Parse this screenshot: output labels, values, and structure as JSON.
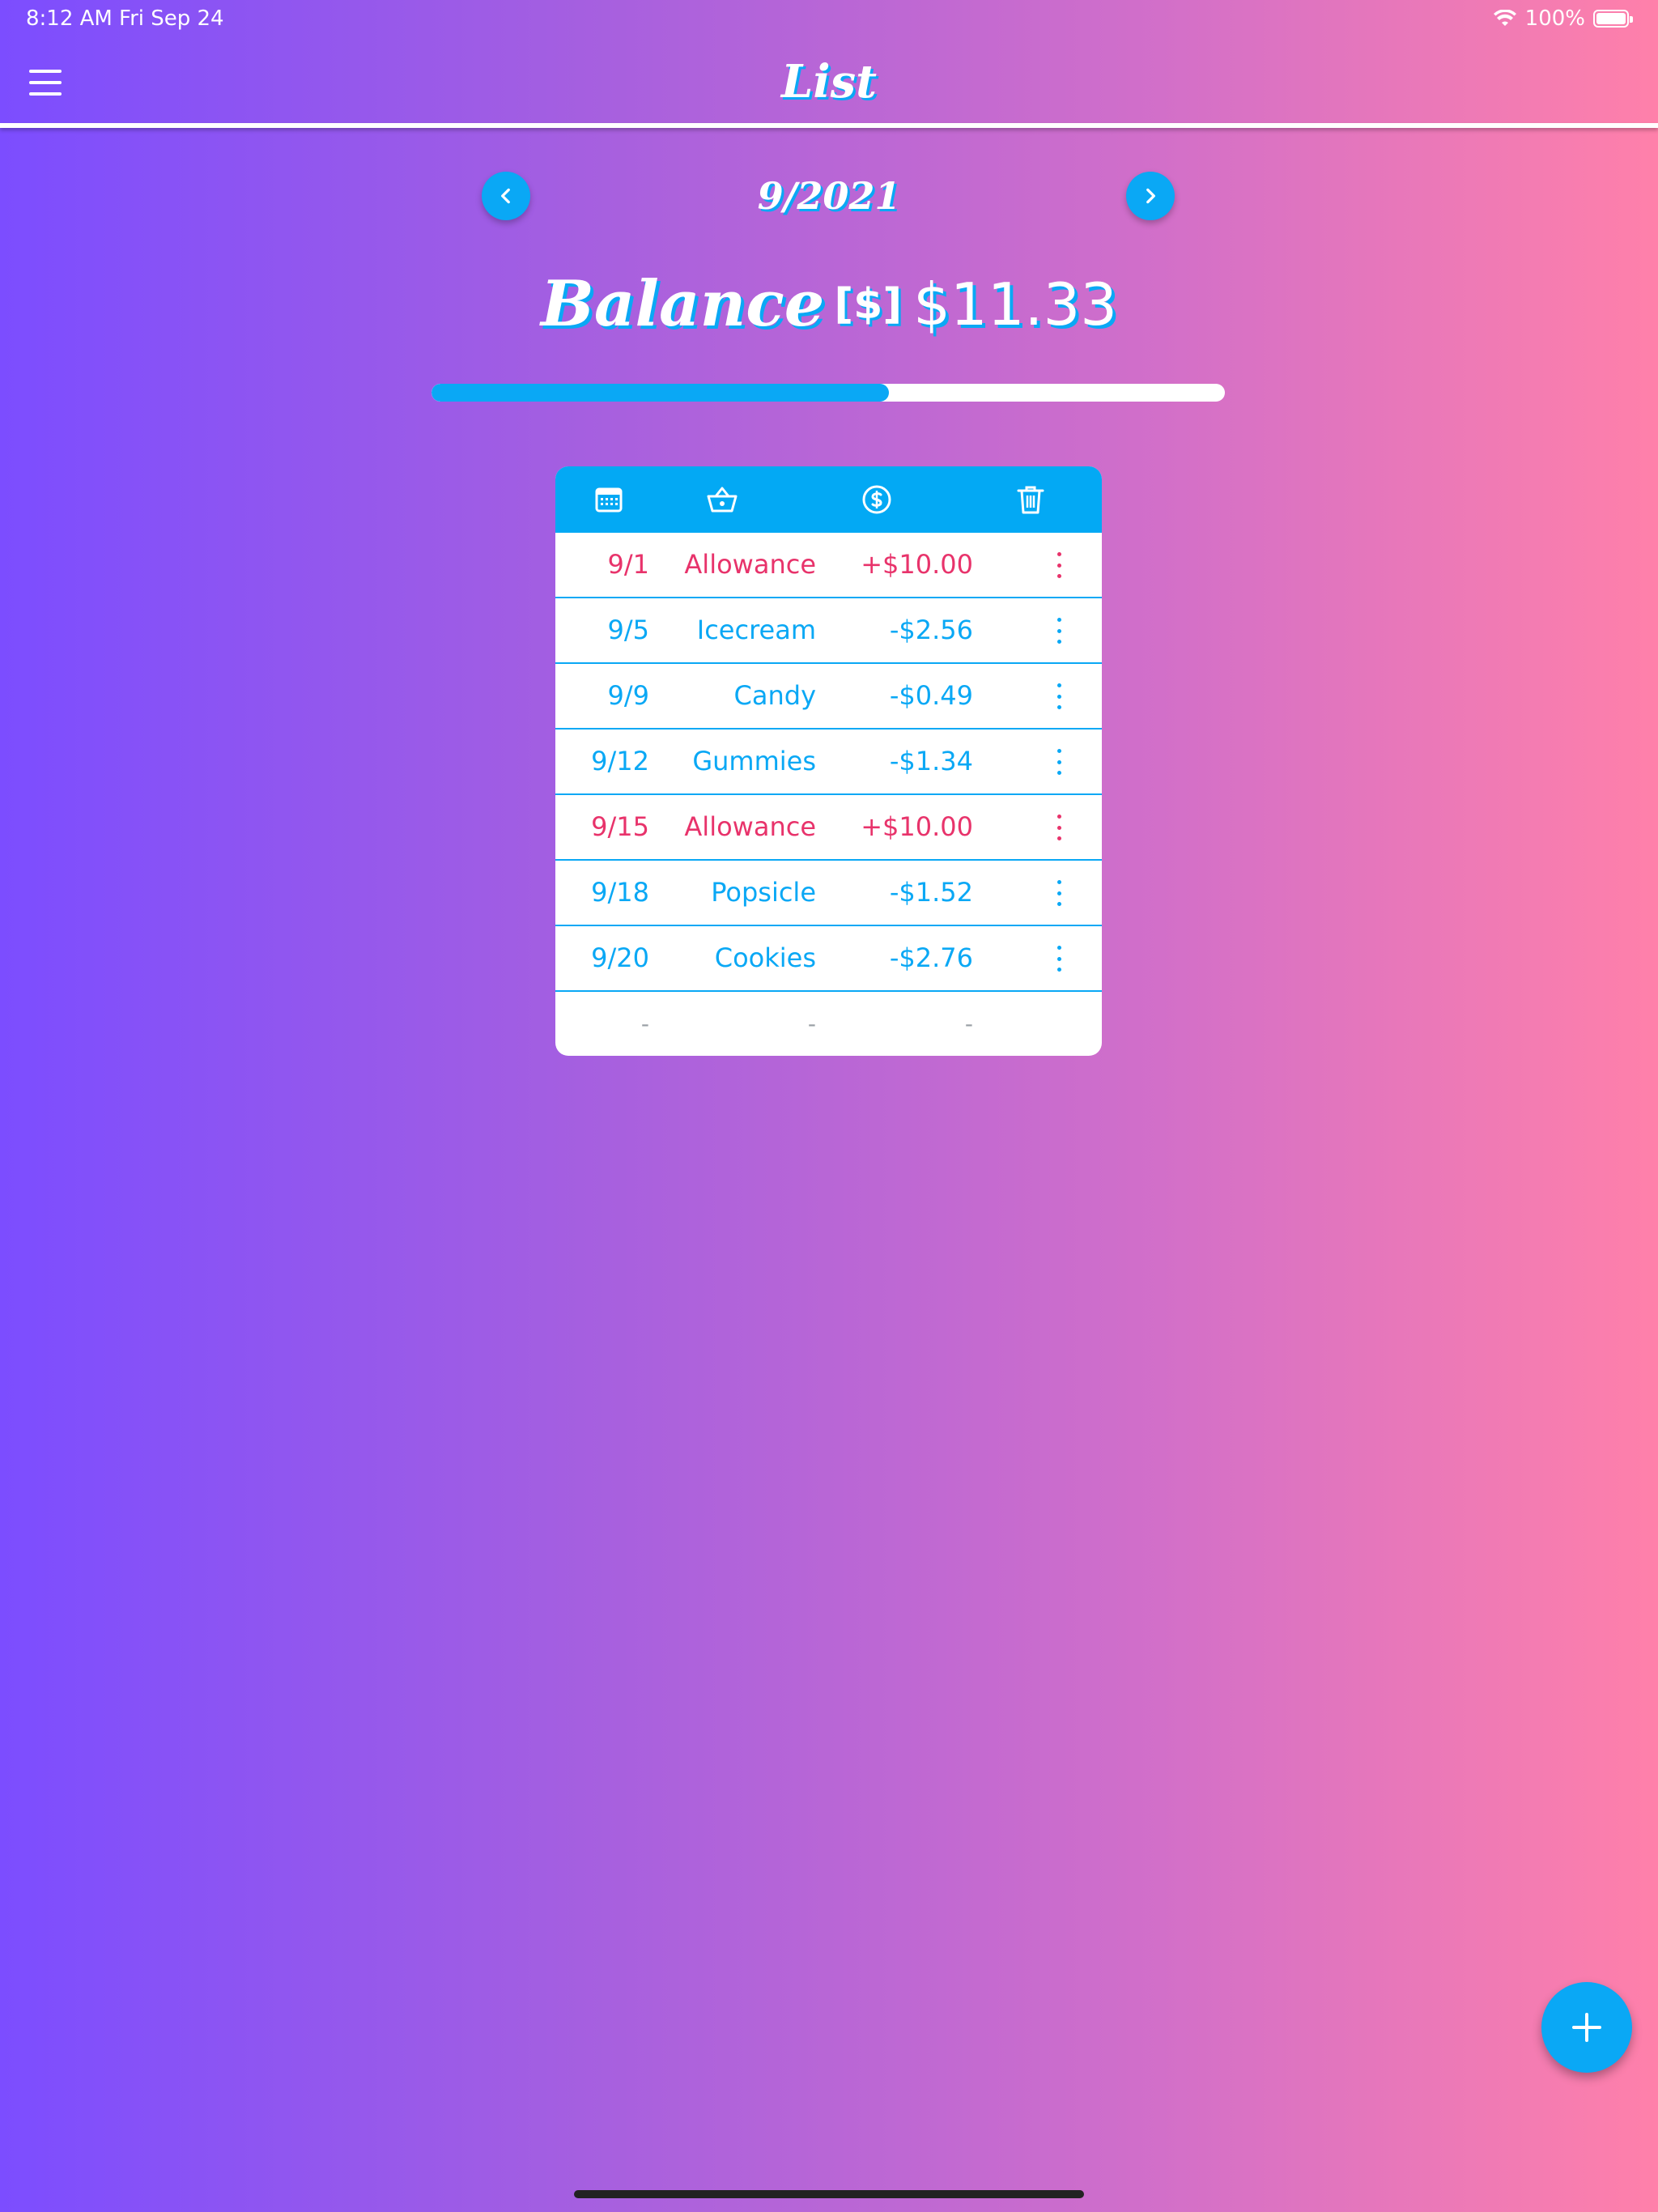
{
  "status_bar": {
    "time": "8:12 AM",
    "date": "Fri Sep 24",
    "battery": "100%",
    "icons": [
      "wifi-icon",
      "battery-icon"
    ]
  },
  "nav": {
    "title": "List",
    "menu_icon": "hamburger-menu-icon"
  },
  "month": {
    "label": "9/2021",
    "prev_icon": "chevron-left-icon",
    "next_icon": "chevron-right-icon"
  },
  "balance": {
    "label": "Balance",
    "unit": "[$]",
    "amount": "$11.33",
    "progress_fraction": 0.577
  },
  "table": {
    "header_icons": [
      "calendar-icon",
      "basket-icon",
      "dollar-circle-icon",
      "trash-icon"
    ],
    "rows": [
      {
        "date": "9/1",
        "item": "Allowance",
        "amount": "+$10.00",
        "type": "income"
      },
      {
        "date": "9/5",
        "item": "Icecream",
        "amount": "-$2.56",
        "type": "expense"
      },
      {
        "date": "9/9",
        "item": "Candy",
        "amount": "-$0.49",
        "type": "expense"
      },
      {
        "date": "9/12",
        "item": "Gummies",
        "amount": "-$1.34",
        "type": "expense"
      },
      {
        "date": "9/15",
        "item": "Allowance",
        "amount": "+$10.00",
        "type": "income"
      },
      {
        "date": "9/18",
        "item": "Popsicle",
        "amount": "-$1.52",
        "type": "expense"
      },
      {
        "date": "9/20",
        "item": "Cookies",
        "amount": "-$2.76",
        "type": "expense"
      }
    ],
    "empty_row": {
      "date": "-",
      "item": "-",
      "amount": "-"
    }
  },
  "fab": {
    "icon": "plus-icon"
  },
  "colors": {
    "accent": "#0aa8f5",
    "income": "#e8336b",
    "gradient_start": "#7c4dff",
    "gradient_end": "#ff80aa"
  }
}
